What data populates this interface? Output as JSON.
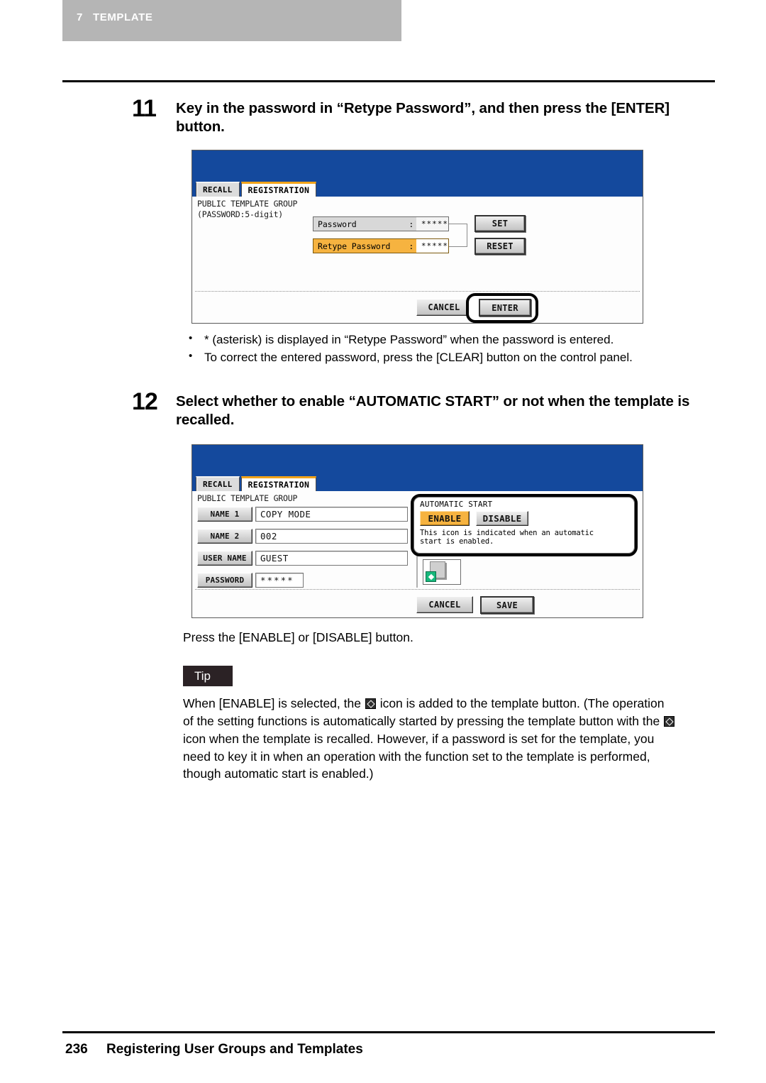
{
  "header": {
    "chapter_number": "7",
    "chapter_title": "TEMPLATE"
  },
  "steps": [
    {
      "number": "11",
      "text": "Key in the password in “Retype Password”, and then press the [ENTER] button."
    },
    {
      "number": "12",
      "text": "Select whether to enable “AUTOMATIC START” or not when the template is recalled."
    }
  ],
  "panel1": {
    "tabs": [
      {
        "label": "RECALL",
        "active": false
      },
      {
        "label": "REGISTRATION",
        "active": true
      }
    ],
    "group_title": "PUBLIC TEMPLATE GROUP\n(PASSWORD:5-digit)",
    "fields": [
      {
        "label": "Password",
        "colon": ":",
        "value": "*****",
        "highlighted": false
      },
      {
        "label": "Retype Password",
        "colon": ":",
        "value": "*****",
        "highlighted": true
      }
    ],
    "side_buttons": [
      {
        "label": "SET"
      },
      {
        "label": "RESET"
      }
    ],
    "footer_buttons": [
      {
        "label": "CANCEL"
      },
      {
        "label": "ENTER"
      }
    ]
  },
  "panel1_notes": [
    "* (asterisk) is displayed in “Retype Password” when the password is entered.",
    "To correct the entered password, press the [CLEAR] button on the control panel."
  ],
  "panel2": {
    "tabs": [
      {
        "label": "RECALL",
        "active": false
      },
      {
        "label": "REGISTRATION",
        "active": true
      }
    ],
    "group_title": "PUBLIC TEMPLATE GROUP",
    "fields": [
      {
        "key": "NAME 1",
        "value": "COPY MODE"
      },
      {
        "key": "NAME 2",
        "value": "002"
      },
      {
        "key": "USER NAME",
        "value": "GUEST"
      },
      {
        "key": "PASSWORD",
        "value": "*****"
      }
    ],
    "automatic_start": {
      "title": "AUTOMATIC START",
      "enable_label": "ENABLE",
      "disable_label": "DISABLE",
      "selected": "ENABLE",
      "note": "This icon is indicated when an automatic\nstart is enabled."
    },
    "thumbnail_icon": "automatic-start-diamond-icon",
    "footer_buttons": [
      {
        "label": "CANCEL"
      },
      {
        "label": "SAVE"
      }
    ]
  },
  "press_line": "Press the [ENABLE] or [DISABLE] button.",
  "tip": {
    "badge": "Tip",
    "lines": [
      {
        "pre": "When [ENABLE] is selected, the ",
        "icon": true,
        "post": " icon is added to the template button. (The operation"
      },
      {
        "pre": "of the setting functions is automatically started by pressing the template button with the ",
        "icon": true,
        "post": ""
      },
      {
        "pre": "icon when the template is recalled. However, if a password is set for the template, you",
        "icon": false,
        "post": ""
      },
      {
        "pre": "need to key it in when an operation with the function set to the template is performed,",
        "icon": false,
        "post": ""
      },
      {
        "pre": "though automatic start is enabled.)",
        "icon": false,
        "post": ""
      }
    ]
  },
  "footer": {
    "page_number": "236",
    "section_title": "Registering User Groups and Templates"
  },
  "colors": {
    "panel_header_blue": "#14499d",
    "highlight_amber": "#f6b340",
    "chapter_band_grey": "#b5b5b5",
    "tip_badge": "#2b2225",
    "auto_icon_green": "#17b77b"
  }
}
